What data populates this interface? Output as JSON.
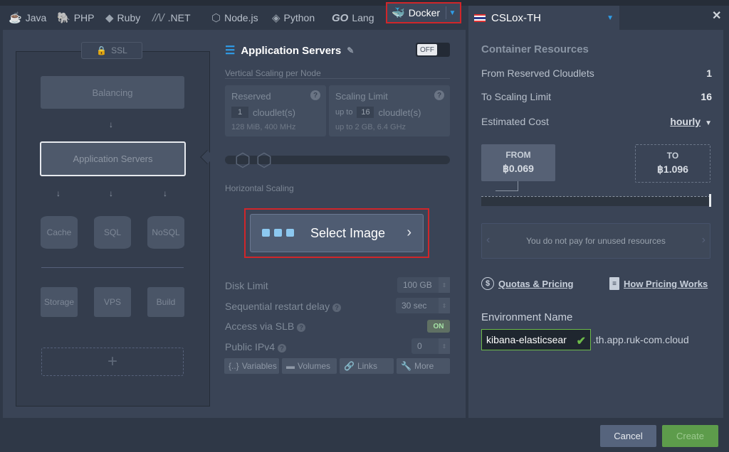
{
  "tabs": [
    {
      "label": "Java",
      "icon": "java-icon"
    },
    {
      "label": "PHP",
      "icon": "php-elephant-icon"
    },
    {
      "label": "Ruby",
      "icon": "ruby-icon"
    },
    {
      "label": ".NET",
      "icon": "dotnet-icon"
    },
    {
      "label": "Node.js",
      "icon": "nodejs-icon"
    },
    {
      "label": "Python",
      "icon": "python-icon"
    },
    {
      "label": "Lang",
      "icon": "go-icon",
      "prefix": "GO"
    },
    {
      "label": "Docker",
      "icon": "docker-icon",
      "active": true
    }
  ],
  "region": {
    "name": "CSLox-TH"
  },
  "topology": {
    "ssl": "SSL",
    "balancing": "Balancing",
    "app_servers": "Application Servers",
    "cache": "Cache",
    "sql": "SQL",
    "nosql": "NoSQL",
    "storage": "Storage",
    "vps": "VPS",
    "build": "Build",
    "add": "+"
  },
  "config": {
    "title": "Application Servers",
    "toggle": "OFF",
    "vertical_label": "Vertical Scaling per Node",
    "reserved": {
      "title": "Reserved",
      "value": "1",
      "unit": "cloudlet(s)",
      "info": "128 MiB, 400 MHz"
    },
    "limit": {
      "title": "Scaling Limit",
      "prefix": "up to",
      "value": "16",
      "unit": "cloudlet(s)",
      "info": "up to 2 GB, 6.4 GHz"
    },
    "horizontal_label": "Horizontal Scaling",
    "select_image": "Select Image",
    "disk_limit": {
      "label": "Disk Limit",
      "value": "100 GB"
    },
    "restart_delay": {
      "label": "Sequential restart delay",
      "value": "30",
      "unit": "sec"
    },
    "slb": {
      "label": "Access via SLB",
      "toggle": "ON"
    },
    "ipv4": {
      "label": "Public IPv4",
      "value": "0"
    },
    "buttons": [
      "Variables",
      "Volumes",
      "Links",
      "More"
    ]
  },
  "resources": {
    "title": "Container Resources",
    "from_reserved_label": "From Reserved Cloudlets",
    "from_reserved_value": "1",
    "to_limit_label": "To Scaling Limit",
    "to_limit_value": "16",
    "estimated_cost_label": "Estimated Cost",
    "period": "hourly",
    "from_label": "FROM",
    "from_value": "฿0.069",
    "to_label": "TO",
    "to_value": "฿1.096",
    "unused_note": "You do not pay for unused resources",
    "quotas_link": "Quotas & Pricing",
    "how_link": "How Pricing Works"
  },
  "environment": {
    "label": "Environment Name",
    "value": "kibana-elasticsear",
    "domain": ".th.app.ruk-com.cloud"
  },
  "footer": {
    "cancel": "Cancel",
    "create": "Create"
  },
  "colors": {
    "accent": "#2f9de8",
    "highlight": "#d0262a",
    "success": "#6dbb4a"
  }
}
